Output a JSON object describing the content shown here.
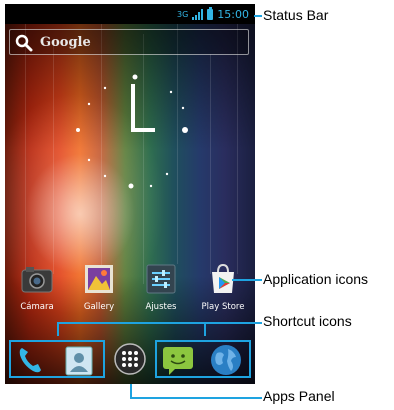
{
  "status_bar": {
    "network": "3G",
    "time": "15:00"
  },
  "search": {
    "label": "Google",
    "icon": "search-icon"
  },
  "apps": [
    {
      "label": "Cámara",
      "icon": "camera-icon"
    },
    {
      "label": "Gallery",
      "icon": "gallery-icon"
    },
    {
      "label": "Ajustes",
      "icon": "settings-icon"
    },
    {
      "label": "Play Store",
      "icon": "play-store-icon"
    }
  ],
  "dock": {
    "left_shortcuts": [
      "phone-icon",
      "contacts-icon"
    ],
    "apps_panel": "apps-grid-icon",
    "right_shortcuts": [
      "messaging-icon",
      "browser-globe-icon"
    ]
  },
  "annotations": {
    "status_bar": "Status Bar",
    "application_icons": "Application icons",
    "shortcut_icons": "Shortcut icons",
    "apps_panel": "Apps Panel"
  },
  "colors": {
    "accent": "#1ea3e0",
    "status_blue": "#33b5e5"
  }
}
